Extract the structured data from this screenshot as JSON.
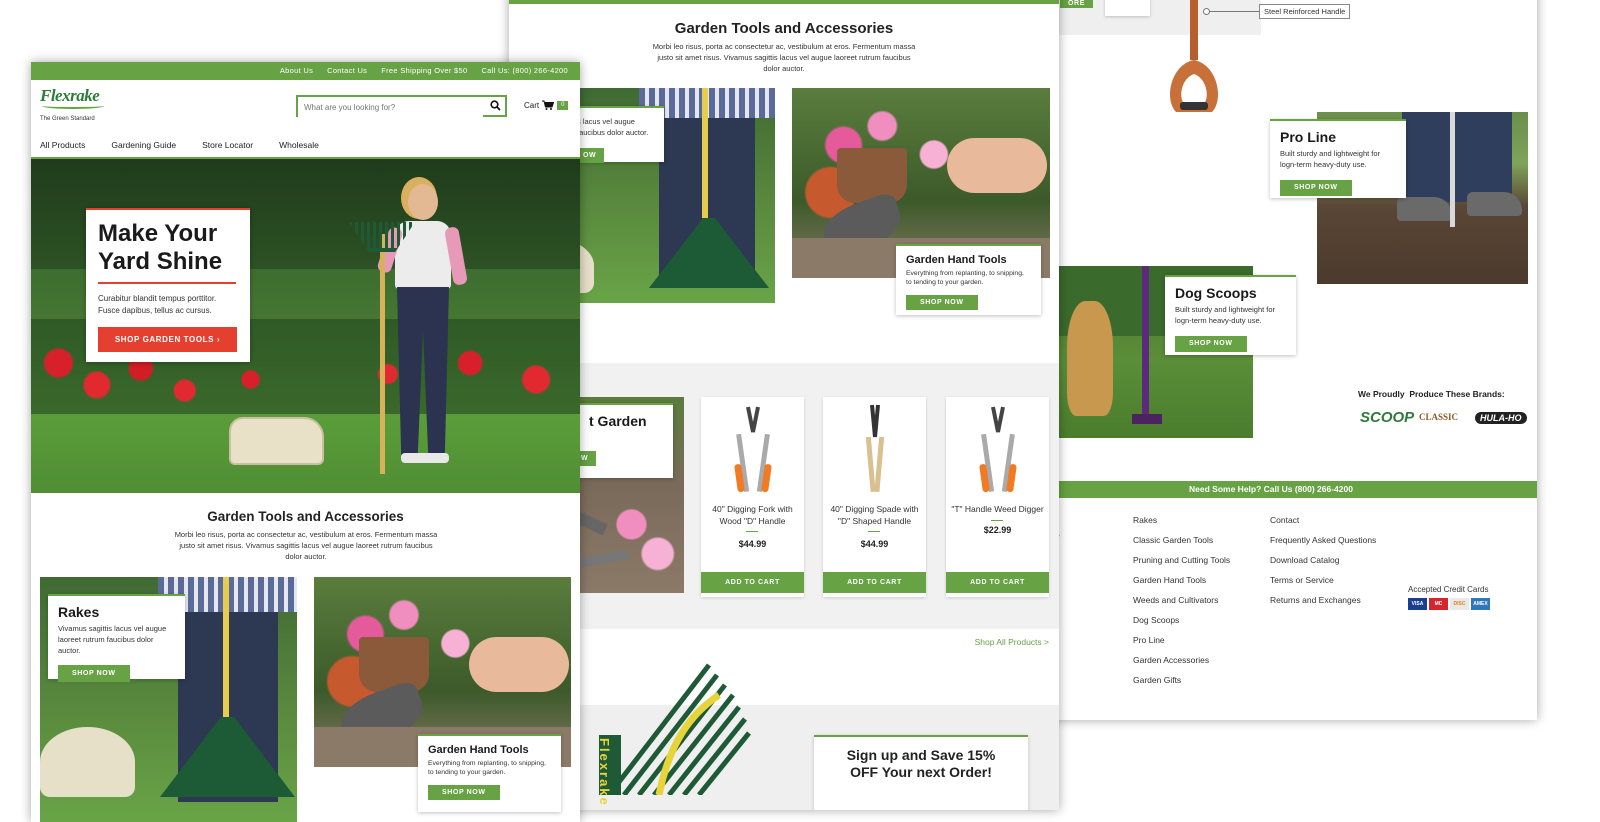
{
  "brand": {
    "logo": "Flexrake",
    "tagline": "The Green Standard",
    "color": "#67a244",
    "accent": "#e5402f"
  },
  "topbar": {
    "links": [
      "About Us",
      "Contact Us",
      "Free Shipping Over $50",
      "Call Us: (800) 266-4200"
    ]
  },
  "search": {
    "placeholder": "What are you looking for?",
    "icon": "search-icon"
  },
  "cart": {
    "label": "Cart",
    "count": "0"
  },
  "nav": [
    "All Products",
    "Gardening Guide",
    "Store Locator",
    "Wholesale"
  ],
  "hero": {
    "title_line1": "Make Your",
    "title_line2": "Yard Shine",
    "body_line1": "Curabitur blandit tempus porttitor.",
    "body_line2": "Fusce dapibus, tellus ac cursus.",
    "cta": "SHOP GARDEN TOOLS ›"
  },
  "section": {
    "title": "Garden Tools and Accessories",
    "body": "Morbi leo risus, porta ac consectetur ac, vestibulum at eros. Fermentum massa justo sit amet risus. Vivamus sagittis lacus vel augue laoreet rutrum faucibus dolor auctor."
  },
  "cards": {
    "rakes": {
      "title": "Rakes",
      "body": "Vivamus sagittis lacus vel augue laoreet rutrum faucibus dolor auctor.",
      "cta": "SHOP NOW"
    },
    "hand_tools": {
      "title": "Garden Hand Tools",
      "body": "Everything from replanting, to snipping, to tending to your garden.",
      "cta": "SHOP NOW"
    },
    "pro_line": {
      "title": "Pro Line",
      "body": "Built sturdy and lightweight for logn-term heavy-duty use.",
      "cta": "SHOP NOW"
    },
    "dog_scoops": {
      "title": "Dog Scoops",
      "body": "Built sturdy and lightweight for logn-term heavy-duty use.",
      "cta": "SHOP NOW"
    },
    "partial_garden": {
      "title": "t Garden",
      "cta": "OW"
    },
    "partial_rakes_body": "s lacus vel augue faucibus dolor auctor.",
    "partial_rakes_cta": "OW",
    "partial_more": "ORE"
  },
  "products": [
    {
      "name": "40\" Digging Fork with Wood \"D\" Handle",
      "price": "$44.99",
      "cta": "ADD TO CART"
    },
    {
      "name": "40\" Digging Spade with \"D\" Shaped Handle",
      "price": "$44.99",
      "cta": "ADD TO CART"
    },
    {
      "name": "\"T\" Handle Weed Digger",
      "price": "$22.99",
      "cta": "ADD TO CART"
    }
  ],
  "shop_all": "Shop All Products >",
  "signup": {
    "line1": "Sign up and Save 15%",
    "line2": "OFF Your next Order!"
  },
  "callout": "Steel Reinforced Handle",
  "brands": {
    "title": "We Proudly  Produce These Brands:",
    "items": [
      "SCOOP",
      "CLASSIC",
      "HULA-HO"
    ]
  },
  "help_bar": "Need Some Help? Call Us (800) 266-4200",
  "footer": {
    "col1": [
      "Rakes",
      "Classic Garden Tools",
      "Pruning and Cutting Tools",
      "Garden Hand Tools",
      "Weeds and Cultivators",
      "Dog Scoops",
      "Pro Line",
      "Garden Accessories",
      "Garden Gifts"
    ],
    "col2": [
      "Contact",
      "Frequently Asked Questions",
      "Download Catalog",
      "Terms or Service",
      "Returns and Exchanges"
    ],
    "partial_e": "e",
    "credit_title": "Accepted Credit Cards",
    "cards": [
      "VISA",
      "MC",
      "DISC",
      "AMEX"
    ]
  }
}
